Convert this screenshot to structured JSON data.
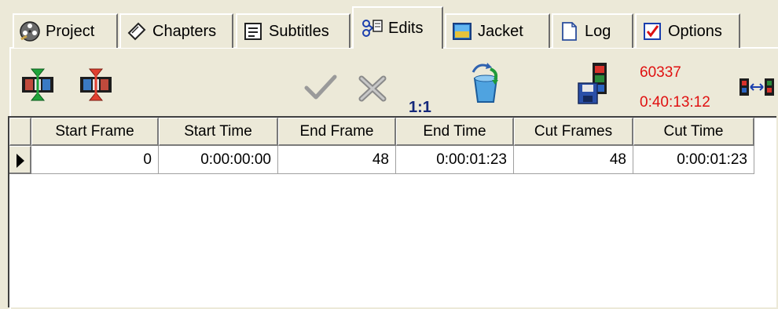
{
  "tabs": [
    {
      "label": "Project",
      "icon": "film-reel-icon"
    },
    {
      "label": "Chapters",
      "icon": "chapter-tag-icon"
    },
    {
      "label": "Subtitles",
      "icon": "subtitles-doc-icon"
    },
    {
      "label": "Edits",
      "icon": "scissors-doc-icon",
      "active": true
    },
    {
      "label": "Jacket",
      "icon": "jacket-image-icon"
    },
    {
      "label": "Log",
      "icon": "log-page-icon"
    },
    {
      "label": "Options",
      "icon": "checkbox-icon"
    }
  ],
  "toolbar": {
    "ratio": "1:1",
    "frame_count": "60337",
    "total_time": "0:40:13:12"
  },
  "grid": {
    "columns": [
      "Start Frame",
      "Start Time",
      "End Frame",
      "End Time",
      "Cut Frames",
      "Cut Time"
    ],
    "rows": [
      [
        "0",
        "0:00:00:00",
        "48",
        "0:00:01:23",
        "48",
        "0:00:01:23"
      ]
    ]
  },
  "colors": {
    "window_bg": "#ece9d8",
    "counter_red": "#e01010",
    "ratio_blue": "#14287a"
  }
}
